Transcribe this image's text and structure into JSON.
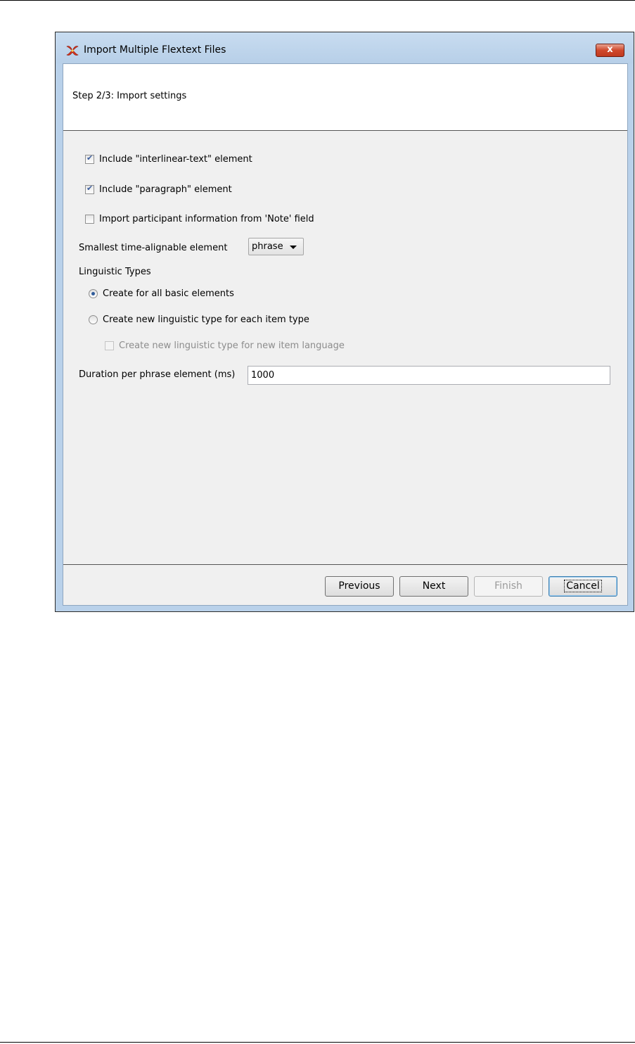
{
  "window": {
    "title": "Import Multiple Flextext Files",
    "close_label": "x"
  },
  "header": {
    "step_title": "Step 2/3: Import settings"
  },
  "options": {
    "include_interlinear": {
      "label": "Include \"interlinear-text\" element",
      "checked": true
    },
    "include_paragraph": {
      "label": "Include \"paragraph\" element",
      "checked": true
    },
    "import_participant": {
      "label": "Import participant information from 'Note' field",
      "checked": false
    },
    "smallest_element": {
      "label": "Smallest time-alignable element",
      "value": "phrase"
    },
    "linguistic_types": {
      "label": "Linguistic Types",
      "radio_basic": {
        "label": "Create for all basic elements",
        "selected": true
      },
      "radio_each_item": {
        "label": "Create new linguistic type for each item type",
        "selected": false
      },
      "check_new_language": {
        "label": "Create new linguistic type for new item language",
        "checked": false,
        "enabled": false
      }
    },
    "duration": {
      "label": "Duration per phrase element (ms)",
      "value": "1000"
    }
  },
  "footer": {
    "previous": "Previous",
    "next": "Next",
    "finish": "Finish",
    "cancel": "Cancel"
  },
  "colors": {
    "titlebar": "#b9d1ea",
    "client_bg": "#f0f0f0",
    "close_button": "#c8452a"
  }
}
